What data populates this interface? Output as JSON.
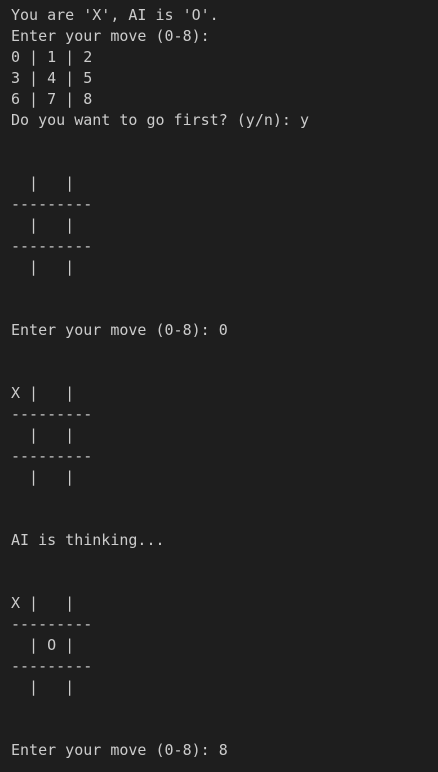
{
  "terminal": {
    "lines": [
      "You are 'X', AI is 'O'.",
      "Enter your move (0-8):",
      "0 | 1 | 2",
      "3 | 4 | 5",
      "6 | 7 | 8",
      "Do you want to go first? (y/n): y",
      "",
      "",
      "  |   |",
      "---------",
      "  |   |",
      "---------",
      "  |   |",
      "",
      "",
      "Enter your move (0-8): 0",
      "",
      "",
      "X |   |",
      "---------",
      "  |   |",
      "---------",
      "  |   |",
      "",
      "",
      "AI is thinking...",
      "",
      "",
      "X |   |",
      "---------",
      "  | O |",
      "---------",
      "  |   |",
      "",
      "",
      "Enter your move (0-8): 8"
    ]
  }
}
